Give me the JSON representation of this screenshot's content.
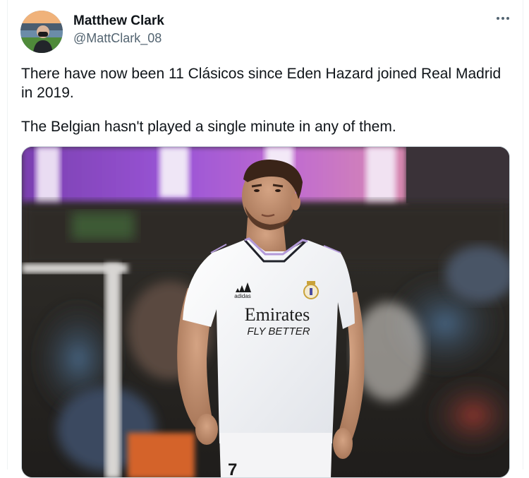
{
  "tweet": {
    "author": {
      "name": "Matthew Clark",
      "handle": "@MattClark_08",
      "avatar_icon": "profile-photo"
    },
    "more_icon": "ellipsis-icon",
    "paragraphs": [
      "There have now been 11 Clásicos since Eden Hazard joined Real Madrid in 2019.",
      "The Belgian hasn't played a single minute in any of them."
    ],
    "media": {
      "kind": "photo",
      "shirt_sponsor_line1": "Emirates",
      "shirt_sponsor_line2": "FLY BETTER",
      "shirt_brand": "adidas",
      "shirt_number": "7"
    }
  }
}
